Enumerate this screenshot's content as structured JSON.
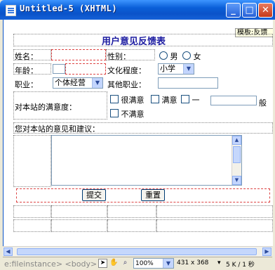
{
  "window": {
    "title": "Untitled-5 (XHTML)",
    "minimize_glyph": "_",
    "maximize_glyph": "□",
    "close_glyph": "✕"
  },
  "form": {
    "heading": "用户意见反馈表",
    "template_tag": "模板:反馈",
    "name_label": "姓名：",
    "gender_label": "性别：",
    "gender_options": [
      "男",
      "女"
    ],
    "age_label": "年龄：",
    "education_label": "文化程度：",
    "education_value": "小学",
    "occupation_label": "职业：",
    "occupation_value": "个体经营",
    "other_occupation_label": "其他职业：",
    "satisfaction_label": "对本站的满意度：",
    "satisfaction_options": [
      "很满意",
      "满意",
      "一",
      "般",
      "不满意"
    ],
    "comments_label": "您对本站的意见和建议：",
    "submit_label": "提交",
    "reset_label": "重置"
  },
  "statusbar": {
    "tag_path": "e:fileinstance> <body>",
    "zoom": "100%",
    "dimensions": "431 x 368",
    "filesize": "5 K / 1 秒"
  },
  "icons": [
    "page-icon",
    "pointer-tool-icon",
    "hand-tool-icon",
    "zoom-tool-icon"
  ]
}
